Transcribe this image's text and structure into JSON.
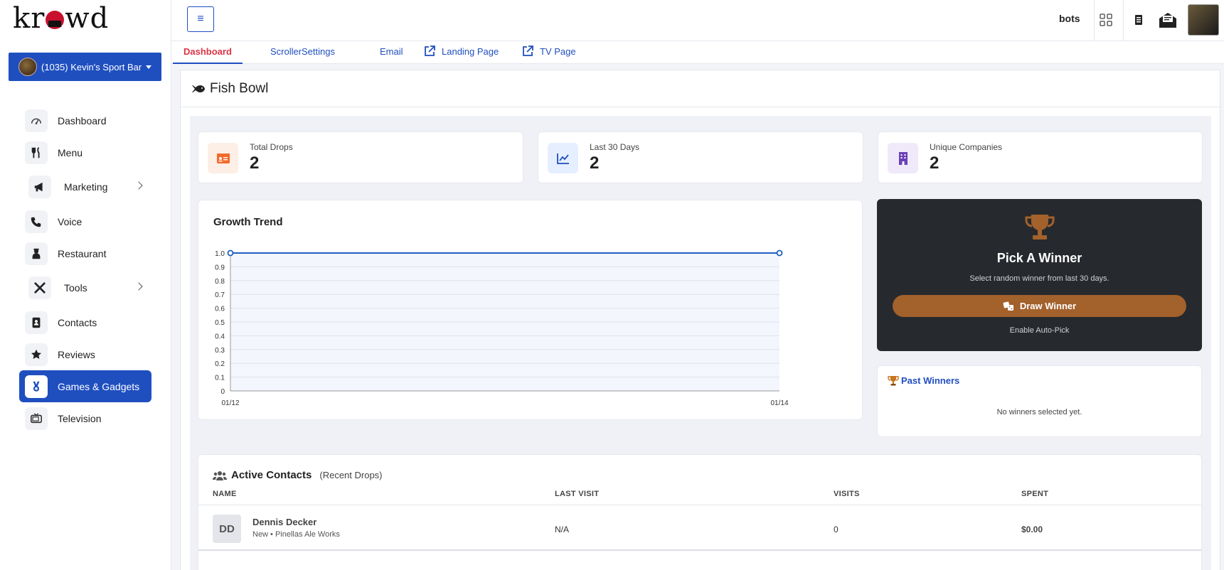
{
  "app": {
    "logo_text": "krowd",
    "venue_label": "(1035) Kevin's Sport Bar"
  },
  "sidebar": {
    "items": [
      {
        "label": "Dashboard",
        "icon": "gauge-icon"
      },
      {
        "label": "Menu",
        "icon": "utensils-icon"
      },
      {
        "label": "Marketing",
        "icon": "megaphone-icon",
        "expandable": true
      },
      {
        "label": "Voice",
        "icon": "phone-icon"
      },
      {
        "label": "Restaurant",
        "icon": "waiter-icon"
      },
      {
        "label": "Tools",
        "icon": "tools-icon",
        "expandable": true
      },
      {
        "label": "Contacts",
        "icon": "address-book-icon"
      },
      {
        "label": "Reviews",
        "icon": "star-icon"
      },
      {
        "label": "Games & Gadgets",
        "icon": "medal-icon",
        "active": true
      },
      {
        "label": "Television",
        "icon": "tv-icon"
      }
    ]
  },
  "topbar": {
    "menu_glyph": "≡",
    "bots_label": "bots"
  },
  "tabs": [
    {
      "label": "Dashboard",
      "active": true
    },
    {
      "label": "Scroller"
    },
    {
      "label": "Settings"
    },
    {
      "label": "Email"
    },
    {
      "label": "Landing Page",
      "external": true
    },
    {
      "label": "TV Page",
      "external": true
    }
  ],
  "page": {
    "title": "Fish Bowl"
  },
  "stats": [
    {
      "label": "Total Drops",
      "value": "2",
      "icon": "id-card-icon",
      "color": "#f26b2a",
      "bg": "#fdeee6"
    },
    {
      "label": "Last 30 Days",
      "value": "2",
      "icon": "chart-line-icon",
      "color": "#1f4fbf",
      "bg": "#e6efff"
    },
    {
      "label": "Unique Companies",
      "value": "2",
      "icon": "building-icon",
      "color": "#6b3fb8",
      "bg": "#efe9fa"
    }
  ],
  "chart_data": {
    "type": "area",
    "title": "Growth Trend",
    "x": [
      "01/12",
      "01/14"
    ],
    "series": [
      {
        "values": [
          1.0,
          1.0
        ]
      }
    ],
    "ylim": [
      0,
      1.0
    ],
    "yticks": [
      "0",
      "0.1",
      "0.2",
      "0.3",
      "0.4",
      "0.5",
      "0.6",
      "0.7",
      "0.8",
      "0.9",
      "1.0"
    ],
    "grid": true,
    "line_color": "#1f5fbf"
  },
  "winner": {
    "title": "Pick A Winner",
    "subtitle": "Select random winner from last 30 days.",
    "button_label": "Draw Winner",
    "auto_pick_label": "Enable Auto-Pick",
    "accent": "#a3612b"
  },
  "past_winners": {
    "title": "Past Winners",
    "empty_text": "No winners selected yet."
  },
  "contacts": {
    "title": "Active Contacts",
    "subtitle": "(Recent Drops)",
    "columns": [
      "NAME",
      "LAST VISIT",
      "VISITS",
      "SPENT"
    ],
    "rows": [
      {
        "initials": "DD",
        "name": "Dennis Decker",
        "meta": "New • Pinellas Ale Works",
        "last_visit": "N/A",
        "visits": "0",
        "spent": "$0.00"
      }
    ]
  }
}
